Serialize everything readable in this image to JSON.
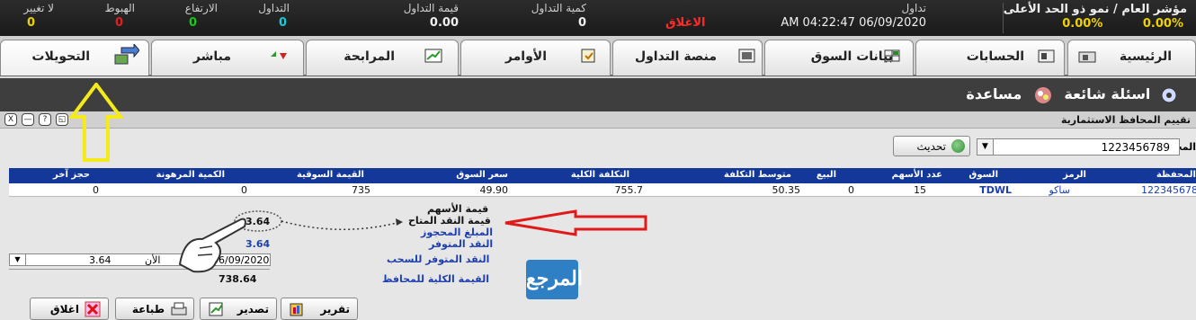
{
  "ticker": {
    "no_change": {
      "label": "لا تغيير",
      "value": "0"
    },
    "decline": {
      "label": "الهبوط",
      "value": "0"
    },
    "rise": {
      "label": "الارتفاع",
      "value": "0"
    },
    "trades": {
      "label": "التداول",
      "value": "0"
    },
    "trade_value": {
      "label": "قيمة التداول",
      "value": "0.00"
    },
    "trade_qty": {
      "label": "كمية التداول",
      "value": "0"
    },
    "session": {
      "label": "تداول",
      "datetime": "AM 04:22:47 06/09/2020",
      "status": "الاغلاق"
    },
    "index": {
      "title": "مؤشر العام / نمو ذو الحد الأعلى",
      "values": "0.00% 0.00%"
    },
    "colors": {
      "rise": "#18c818",
      "decline": "#e02020",
      "neutral": "#f0d000",
      "status": "#ff2a2a"
    }
  },
  "tabs": [
    {
      "label": "الرئيسية",
      "icon": "home-icon"
    },
    {
      "label": "الحسابات",
      "icon": "accounts-icon"
    },
    {
      "label": "بيانات السوق",
      "icon": "market-data-icon"
    },
    {
      "label": "منصة التداول",
      "icon": "trading-platform-icon"
    },
    {
      "label": "الأوامر",
      "icon": "orders-icon"
    },
    {
      "label": "المرابحة",
      "icon": "murabaha-icon"
    },
    {
      "label": "مباشر",
      "icon": "live-icon"
    },
    {
      "label": "التحويلات",
      "icon": "transfers-icon"
    }
  ],
  "help": {
    "help_label": "مساعدة",
    "faq_label": "اسئلة شائعة"
  },
  "window": {
    "title": "تقييم المحافظ الاستثمارية",
    "controls": [
      "X",
      "—",
      "?",
      "◱"
    ],
    "portfolio_label": "المحفظة",
    "portfolio_value": "1223456789",
    "refresh_label": "تحديث"
  },
  "grid": {
    "headers": [
      "المحفظة",
      "الرمز",
      "السوق",
      "عدد الأسهم",
      "البيع",
      "متوسط التكلفة",
      "التكلفة الكلية",
      "سعر السوق",
      "القيمة السوقية",
      "الكمية المرهونة",
      "حجز آخر"
    ],
    "row": [
      "122345678",
      "ساكو",
      "TDWL",
      "15",
      "0",
      "50.35",
      "755.7",
      "49.90",
      "735",
      "0",
      "0"
    ]
  },
  "summary": {
    "stock_value_label": "قيمة الأسهم",
    "cash_available_label": "قيمة النقد المتاح",
    "cash_available_value": "3.64",
    "blocked_label": "المبلغ المحجوز",
    "available_cash_label": "النقد المتوفر",
    "available_cash_value": "3.64",
    "withdraw_label": "النقد المتوفر للسحب",
    "withdraw_date": "06/09/2020",
    "withdraw_now": "الأن",
    "withdraw_value": "3.64",
    "total_label": "القيمة الكلية للمحافظ",
    "total_value": "738.64"
  },
  "buttons": {
    "report": "تقرير",
    "export": "تصدير",
    "print": "طباعة",
    "close": "اغلاق"
  },
  "watermark": "المرجع"
}
